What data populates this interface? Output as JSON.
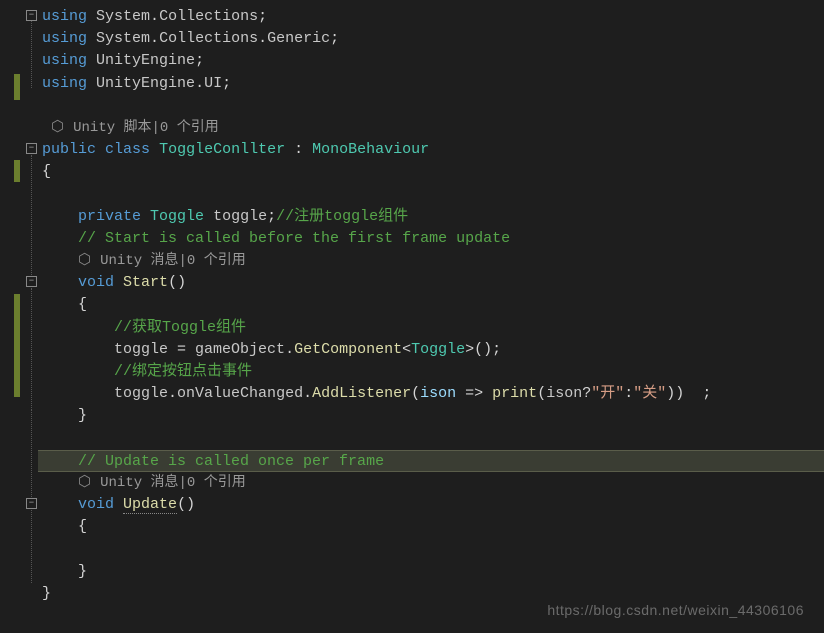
{
  "lines": {
    "l1": {
      "kw": "using",
      "ns1": "System",
      "ns2": "Collections"
    },
    "l2": {
      "kw": "using",
      "ns1": "System",
      "ns2": "Collections",
      "ns3": "Generic"
    },
    "l3": {
      "kw": "using",
      "ns": "UnityEngine"
    },
    "l4": {
      "kw": "using",
      "ns1": "UnityEngine",
      "ns2": "UI"
    },
    "l6": {
      "lens": "Unity 脚本|0 个引用"
    },
    "l7": {
      "kw1": "public",
      "kw2": "class",
      "name": "ToggleConllter",
      "colon": " : ",
      "base": "MonoBehaviour"
    },
    "l8": {
      "brace": "{"
    },
    "l10": {
      "kw": "private",
      "type": "Toggle",
      "field": "toggle",
      "semi": ";",
      "comment": "//注册toggle组件"
    },
    "l11": {
      "comment": "// Start is called before the first frame update"
    },
    "l12": {
      "lens": "Unity 消息|0 个引用"
    },
    "l13": {
      "kw": "void",
      "method": "Start",
      "paren": "()"
    },
    "l14": {
      "brace": "{"
    },
    "l15": {
      "comment": "//获取Toggle组件"
    },
    "l16": {
      "lhs": "toggle",
      "eq": " = ",
      "obj": "gameObject",
      "dot": ".",
      "call": "GetComponent",
      "lt": "<",
      "targ": "Toggle",
      "gt": ">",
      "paren": "()",
      "semi": ";"
    },
    "l17": {
      "comment": "//绑定按钮点击事件"
    },
    "l18": {
      "obj": "toggle",
      "dot1": ".",
      "prop": "onValueChanged",
      "dot2": ".",
      "method": "AddListener",
      "lp": "(",
      "param": "ison",
      "arrow": " => ",
      "call": "print",
      "lp2": "(",
      "cond": "ison",
      "q": "?",
      "s1": "\"开\"",
      "colon": ":",
      "s2": "\"关\"",
      "rp2": ")",
      "rp": ")",
      "sp": "  ",
      "semi": ";"
    },
    "l19": {
      "brace": "}"
    },
    "l21": {
      "comment": "// Update is called once per frame"
    },
    "l22": {
      "lens": "Unity 消息|0 个引用"
    },
    "l23": {
      "kw": "void",
      "method": "Update",
      "paren": "()"
    },
    "l24": {
      "brace": "{"
    },
    "l26": {
      "brace": "}"
    },
    "l27": {
      "brace": "}"
    }
  },
  "watermark": "https://blog.csdn.net/weixin_44306106",
  "chart_data": null
}
